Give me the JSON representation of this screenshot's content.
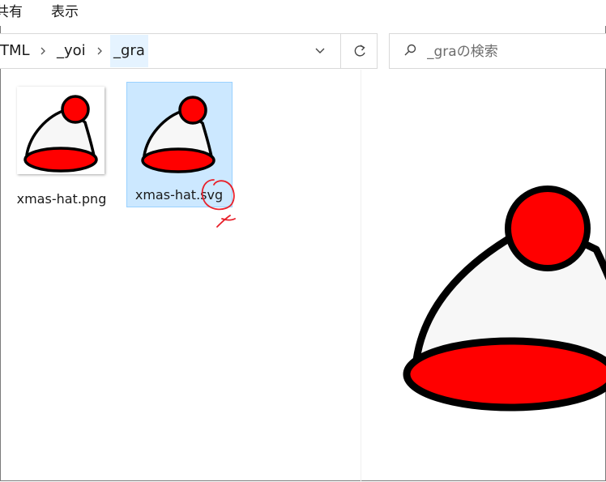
{
  "menu": {
    "share_label": "共有",
    "view_label": "表示"
  },
  "address": {
    "crumbs": [
      "TML",
      "_yoi",
      "_gra"
    ],
    "separator": ">",
    "dropdown_glyph": "⌄",
    "refresh_glyph": "↻"
  },
  "search": {
    "placeholder": "_graの検索",
    "icon": "search-icon"
  },
  "files": [
    {
      "name": "xmas-hat.png",
      "selected": false,
      "icon": "xmas-hat-thumbnail"
    },
    {
      "name": "xmas-hat.svg",
      "selected": true,
      "icon": "xmas-hat-thumbnail"
    }
  ],
  "preview": {
    "icon": "xmas-hat-preview"
  },
  "colors": {
    "selection_bg": "#cce8ff",
    "selection_border": "#99d1ff",
    "hat_red": "#ff0000",
    "hat_white": "#f7f7f7",
    "annotation_red": "#e8202a"
  }
}
